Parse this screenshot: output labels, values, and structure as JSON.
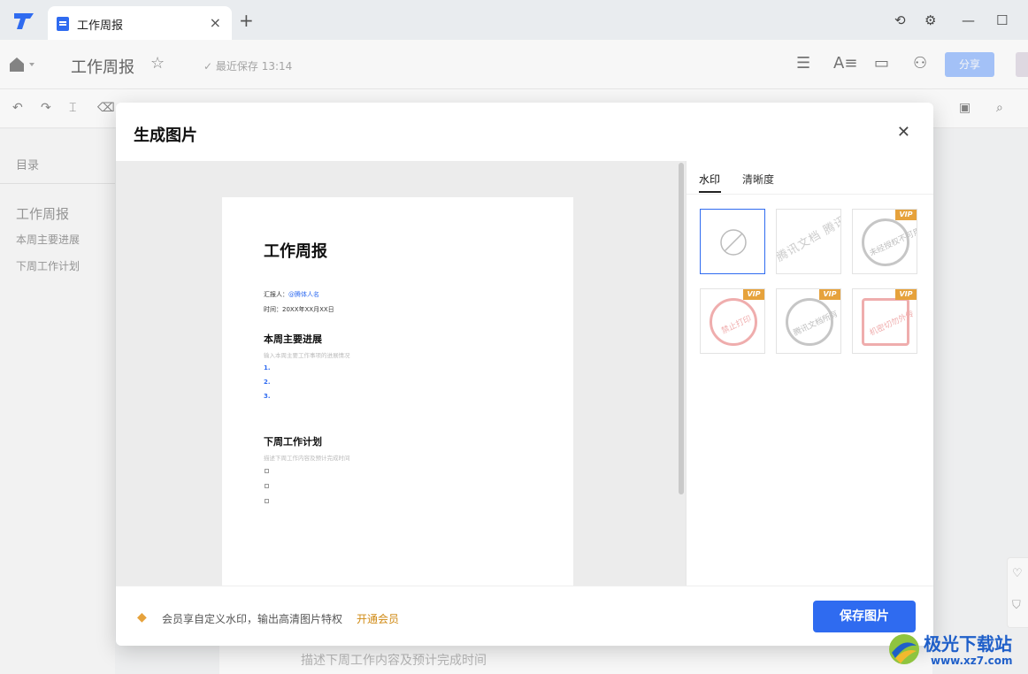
{
  "tab": {
    "title": "工作周报"
  },
  "header": {
    "doc_title": "工作周报",
    "save_status": "最近保存 13:14",
    "share_label": "分享"
  },
  "outline": {
    "heading": "目录",
    "items": [
      "工作周报",
      "本周主要进展",
      "下周工作计划"
    ]
  },
  "background_doc": {
    "hint": "描述下周工作内容及预计完成时间"
  },
  "dialog": {
    "title": "生成图片",
    "tabs": [
      "水印",
      "清晰度"
    ],
    "vip_badge": "VIP",
    "watermarks": [
      {
        "name": "none",
        "vip": false,
        "text": ""
      },
      {
        "name": "tencent-docs",
        "vip": false,
        "text": "腾讯文档 腾讯文档"
      },
      {
        "name": "unauthorized",
        "vip": true,
        "text": "未经授权不可用"
      },
      {
        "name": "forbid-print",
        "vip": true,
        "text": "禁止打印"
      },
      {
        "name": "tencent-copyright",
        "vip": true,
        "text": "腾讯文档所有"
      },
      {
        "name": "confidential",
        "vip": true,
        "text": "机密切勿外传"
      }
    ],
    "footer_text": "会员享自定义水印，输出高清图片特权",
    "footer_link": "开通会员",
    "save_label": "保存图片"
  },
  "preview_page": {
    "title": "工作周报",
    "reporter_label": "汇报人：",
    "reporter_value": "@腾体人名",
    "time_label": "时间：",
    "time_value": "20XX年XX月XX日",
    "section1_title": "本周主要进展",
    "section1_hint": "输入本周主要工作事项的进展情况",
    "section1_items": [
      "1.",
      "2.",
      "3."
    ],
    "section2_title": "下周工作计划",
    "section2_hint": "描述下周工作内容及预计完成时间"
  },
  "site_watermark": {
    "name": "极光下载站",
    "url": "www.xz7.com"
  },
  "colors": {
    "accent": "#2f6bf0",
    "vip": "#e6a23c",
    "link": "#d08a14"
  }
}
